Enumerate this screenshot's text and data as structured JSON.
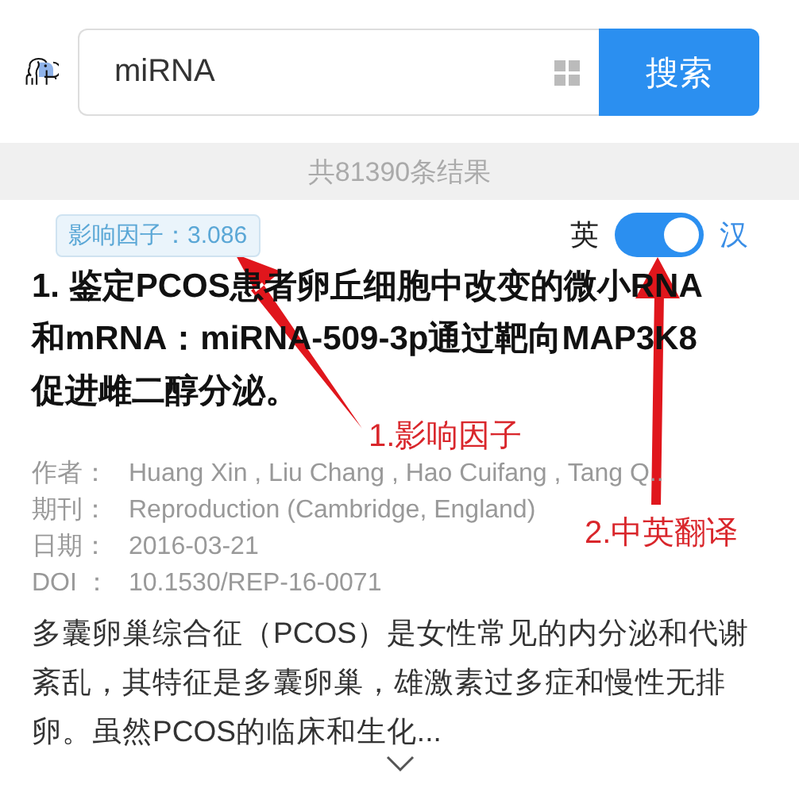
{
  "search": {
    "value": "miRNA",
    "button": "搜索"
  },
  "result_count": "共81390条结果",
  "result": {
    "impact_factor": "影响因子：3.086",
    "language_toggle": {
      "left": "英",
      "right": "汉",
      "on": true
    },
    "number": "1.",
    "title": "鉴定PCOS患者卵丘细胞中改变的微小RNA和mRNA：miRNA-509-3p通过靶向MAP3K8促进雌二醇分泌。",
    "meta": [
      {
        "label": "作者：",
        "value": "Huang Xin , Liu Chang , Hao Cuifang , Tang Q.."
      },
      {
        "label": "期刊：",
        "value": "Reproduction (Cambridge, England)"
      },
      {
        "label": "日期：",
        "value": "2016-03-21"
      },
      {
        "label": "DOI ：",
        "value": "10.1530/REP-16-0071"
      }
    ],
    "abstract": "多囊卵巢综合征（PCOS）是女性常见的内分泌和代谢紊乱，其特征是多囊卵巢，雄激素过多症和慢性无排卵。虽然PCOS的临床和生化..."
  },
  "annotations": [
    {
      "text": "1.影响因子"
    },
    {
      "text": "2.中英翻译"
    }
  ]
}
